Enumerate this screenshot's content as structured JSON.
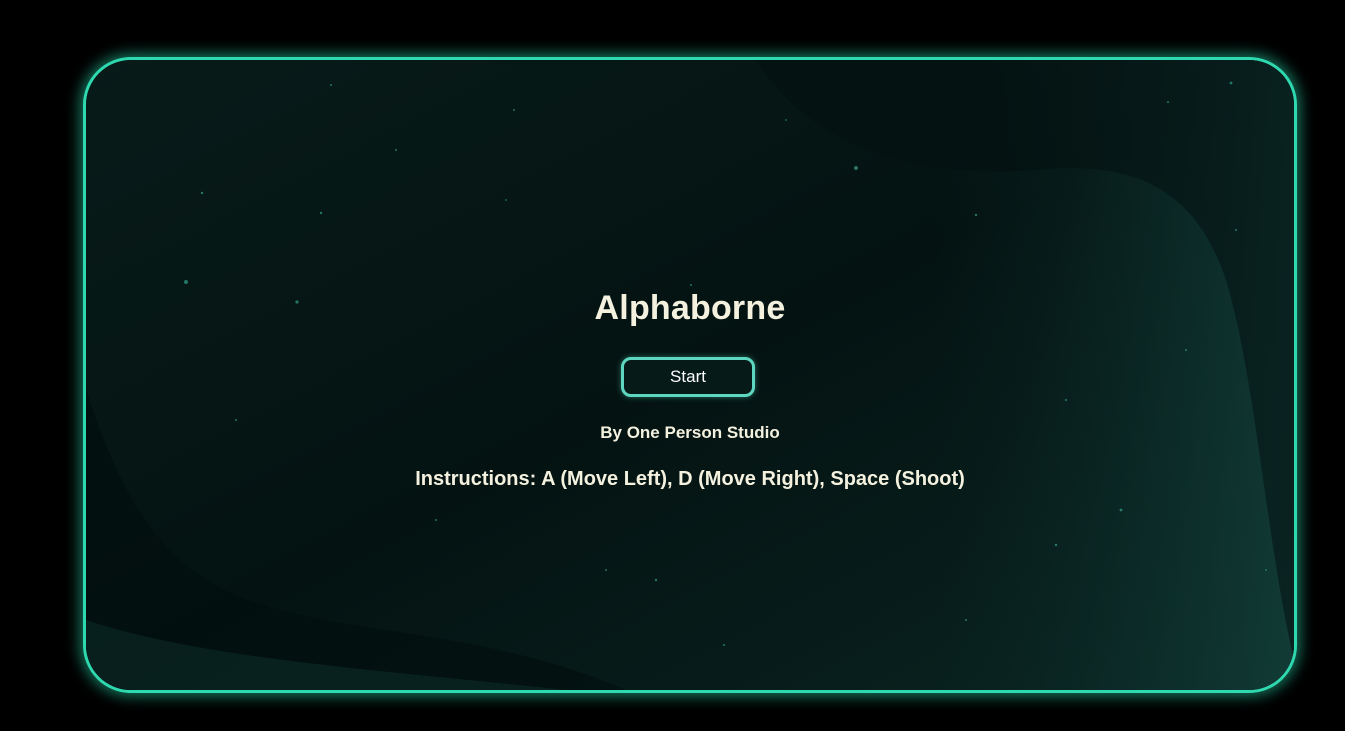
{
  "game": {
    "title": "Alphaborne",
    "start_label": "Start",
    "byline": "By One Person Studio",
    "instructions": "Instructions: A (Move Left), D (Move Right), Space (Shoot)"
  },
  "colors": {
    "frame_glow": "#2fd9b0",
    "background": "#071816",
    "text": "#f4f1df",
    "button_border": "#5fd6bf"
  }
}
